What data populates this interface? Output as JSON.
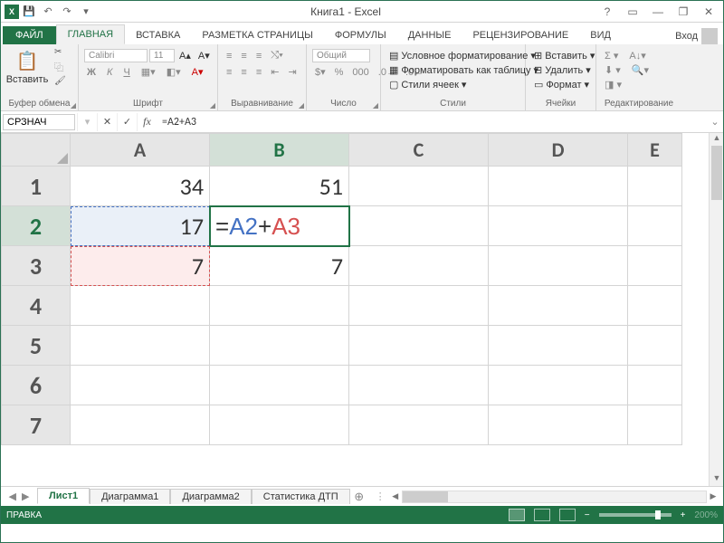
{
  "title": "Книга1 - Excel",
  "qat": {
    "save": "💾",
    "undo": "↶",
    "redo": "↷",
    "customize": "▾"
  },
  "window": {
    "help": "?",
    "ribbon_opts": "▭",
    "min": "—",
    "restore": "❐",
    "close": "✕"
  },
  "tabs": {
    "file": "ФАЙЛ",
    "home": "ГЛАВНАЯ",
    "insert": "ВСТАВКА",
    "pagelayout": "РАЗМЕТКА СТРАНИЦЫ",
    "formulas": "ФОРМУЛЫ",
    "data": "ДАННЫЕ",
    "review": "РЕЦЕНЗИРОВАНИЕ",
    "view": "ВИД",
    "login": "Вход"
  },
  "ribbon": {
    "clipboard": {
      "label": "Буфер обмена",
      "paste": "Вставить"
    },
    "font": {
      "label": "Шрифт",
      "name": "Calibri",
      "size": "11",
      "bold": "Ж",
      "italic": "К",
      "underline": "Ч"
    },
    "alignment": {
      "label": "Выравнивание"
    },
    "number": {
      "label": "Число",
      "format": "Общий"
    },
    "styles": {
      "label": "Стили",
      "cond": "Условное форматирование",
      "table": "Форматировать как таблицу",
      "cell": "Стили ячеек"
    },
    "cells": {
      "label": "Ячейки",
      "insert": "Вставить",
      "delete": "Удалить",
      "format": "Формат"
    },
    "editing": {
      "label": "Редактирование"
    }
  },
  "formula_bar": {
    "name_box": "СРЗНАЧ",
    "formula": "=A2+A3"
  },
  "columns": [
    "A",
    "B",
    "C",
    "D",
    "E"
  ],
  "active_col": "B",
  "rows": [
    "1",
    "2",
    "3",
    "4",
    "5",
    "6",
    "7"
  ],
  "active_row": "2",
  "cells": {
    "A1": "34",
    "B1": "51",
    "A2": "17",
    "B2_prefix": "=",
    "B2_ref1": "A2",
    "B2_op": "+",
    "B2_ref2": "A3",
    "A3": "7",
    "B3": "7"
  },
  "sheets": {
    "items": [
      "Лист1",
      "Диаграмма1",
      "Диаграмма2",
      "Статистика ДТП"
    ],
    "active": 0,
    "add": "⊕"
  },
  "status": {
    "mode": "ПРАВКА",
    "zoom": "200%",
    "minus": "−",
    "plus": "+"
  }
}
